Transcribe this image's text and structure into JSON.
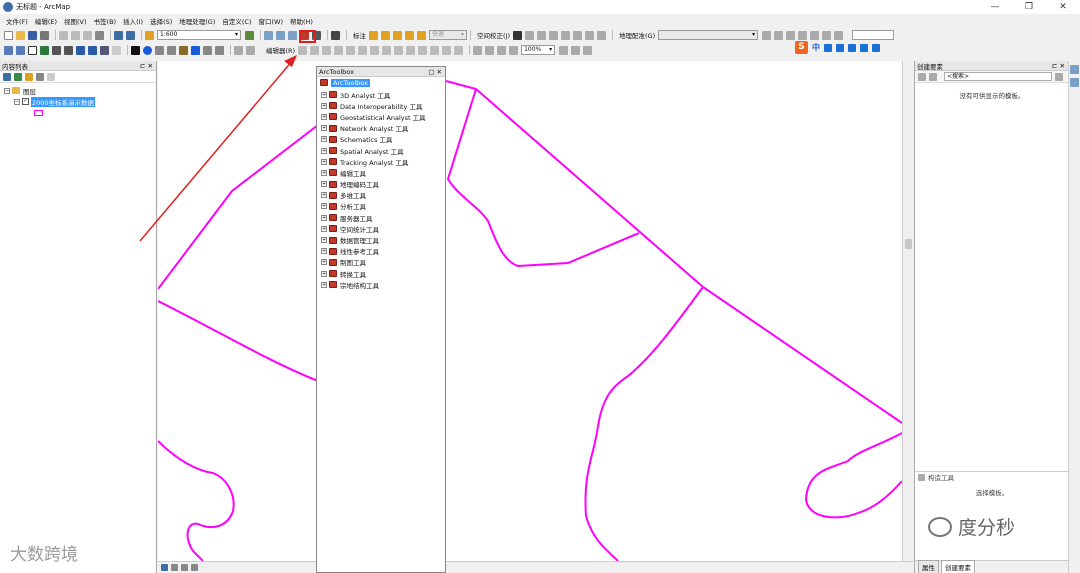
{
  "window": {
    "title": "无标题 - ArcMap",
    "controls": [
      "—",
      "❐",
      "✕"
    ]
  },
  "menu": [
    "文件(F)",
    "编辑(E)",
    "视图(V)",
    "书签(B)",
    "插入(I)",
    "选择(S)",
    "地理处理(G)",
    "自定义(C)",
    "窗口(W)",
    "帮助(H)"
  ],
  "toolbar": {
    "scale": "1:600",
    "annotation_label": "标注",
    "fast_label": "快速",
    "spatial_adjust_label": "空间校正(J)",
    "georef_label": "地理配准(G)",
    "editor_label": "编辑器(R)",
    "zoom_percent": "100%"
  },
  "toc": {
    "title": "内容列表",
    "group": "图层",
    "layer": "2000坐标系演示数据"
  },
  "toolbox": {
    "title": "ArcToolbox",
    "root": "ArcToolbox",
    "items": [
      "3D Analyst 工具",
      "Data Interoperability 工具",
      "Geostatistical Analyst 工具",
      "Network Analyst 工具",
      "Schematics 工具",
      "Spatial Analyst 工具",
      "Tracking Analyst 工具",
      "编辑工具",
      "地理编码工具",
      "多维工具",
      "分析工具",
      "服务器工具",
      "空间统计工具",
      "数据管理工具",
      "线性参考工具",
      "制图工具",
      "转换工具",
      "宗地结构工具"
    ]
  },
  "create_features": {
    "title": "创建要素",
    "search_placeholder": "<搜索>",
    "empty_message": "没有可供显示的模板。",
    "construct_tools_label": "构造工具",
    "select_template_message": "选择模板。",
    "tabs": [
      "属性",
      "创建要素"
    ]
  },
  "ime": {
    "brand": "S",
    "lang": "中"
  },
  "watermarks": {
    "left": "大数跨境",
    "right": "度分秒"
  },
  "colors": {
    "feature_line": "#ff00ff",
    "selection": "#3399ff",
    "highlight": "#e02020"
  }
}
